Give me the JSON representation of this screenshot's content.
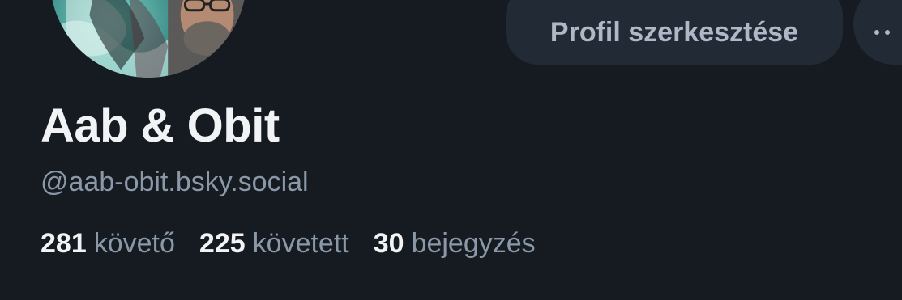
{
  "profile": {
    "display_name": "Aab & Obit",
    "handle": "@aab-obit.bsky.social",
    "avatar_icon": "profile-avatar"
  },
  "actions": {
    "edit_profile_label": "Profil szerkesztése",
    "more_icon": "ellipsis-icon"
  },
  "stats": {
    "followers": {
      "count": "281",
      "label": "követő"
    },
    "following": {
      "count": "225",
      "label": "követett"
    },
    "posts": {
      "count": "30",
      "label": "bejegyzés"
    }
  },
  "colors": {
    "background": "#161b22",
    "button_bg": "#222a35",
    "primary_text": "#f1f3f5",
    "secondary_text": "#8b98a8"
  }
}
